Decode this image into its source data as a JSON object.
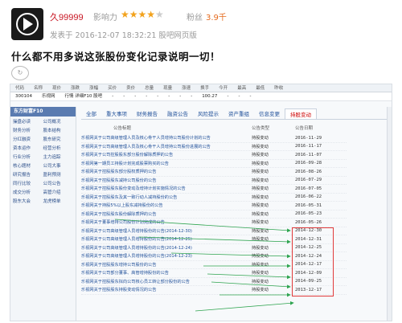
{
  "post": {
    "username": "久99999",
    "influence_label": "影响力",
    "stars_filled": "★★★★",
    "stars_empty": "★",
    "rating": 4,
    "fans_label": "粉丝",
    "fans_value": "3.9千",
    "posted_line": "发表于 2016-12-07 18:32:21 股吧网页版",
    "title": "什么都不用多说这张股份变化记录说明一切！"
  },
  "quote_bar": {
    "headers": [
      "代码",
      "名称",
      "现价",
      "涨跌",
      "涨幅",
      "买价",
      "卖价",
      "总量",
      "现量",
      "涨速",
      "换手",
      "今开",
      "最高",
      "最低",
      "昨收"
    ],
    "row": [
      "300104",
      "乐视网",
      "行情 详细F10 股吧",
      "-",
      "-",
      "-",
      "-",
      "-",
      "-",
      "-",
      "-",
      "100.27",
      "-",
      "-",
      "-"
    ]
  },
  "nav": {
    "title": "东方财富F10",
    "items": [
      "操盘必读",
      "公司概况",
      "财务分析",
      "股本结构",
      "分红融资",
      "股东研究",
      "资本运作",
      "经营分析",
      "行业分析",
      "主力追踪",
      "核心题材",
      "公司大事",
      "研究报告",
      "盈利预测",
      "同行比较",
      "公司公告",
      "成交分析",
      "高管介绍",
      "股东大会",
      "龙虎榜单"
    ]
  },
  "tabs": [
    "全部",
    "重大事项",
    "财务报告",
    "融资公告",
    "风险提示",
    "资产重组",
    "信息变更",
    "持股变动"
  ],
  "columns": {
    "title": "公告标题",
    "type": "公告类型",
    "date": "公告日期"
  },
  "announcements": [
    {
      "title": "乐视网关于公司高级管理人员及核心骨干人员增持公司股份计划的公告",
      "type": "持股变动",
      "date": "2016-11-29"
    },
    {
      "title": "乐视网关于公司高级管理人员及核心骨干人员增持公司股份进展的公告",
      "type": "持股变动",
      "date": "2016-11-17"
    },
    {
      "title": "乐视网关于公司控股股东部分股份解除质押的公告",
      "type": "持股变动",
      "date": "2016-11-07"
    },
    {
      "title": "乐视网第一期员工持股计划完成股票购买的公告",
      "type": "持股变动",
      "date": "2016-09-28"
    },
    {
      "title": "乐视网关于控股股东部分股权质押的公告",
      "type": "持股变动",
      "date": "2016-08-26"
    },
    {
      "title": "乐视网关于控股股东减持公司股份的公告",
      "type": "持股变动",
      "date": "2016-07-29"
    },
    {
      "title": "乐视网关于控股股东股份变动及增持计划实施情况的公告",
      "type": "持股变动",
      "date": "2016-07-05"
    },
    {
      "title": "乐视网关于控股股东及其一致行动人减持股份的公告",
      "type": "持股变动",
      "date": "2016-06-22"
    },
    {
      "title": "乐视网关于持股5%以上股东减持股份的公告",
      "type": "持股变动",
      "date": "2016-05-31"
    },
    {
      "title": "乐视网关于控股股东股份解除质押的公告",
      "type": "持股变动",
      "date": "2016-05-23"
    },
    {
      "title": "乐视网关于董事增持公司股份计划完成的公告",
      "type": "持股变动",
      "date": "2016-05-26"
    },
    {
      "title": "乐视网关于公司高级管理人员增持股份的公告(2014-12-30)",
      "type": "持股变动",
      "date": "2014-12-30"
    },
    {
      "title": "乐视网关于公司高级管理人员增持股份的公告(2014-12-25)",
      "type": "持股变动",
      "date": "2014-12-31"
    },
    {
      "title": "乐视网关于公司高级管理人员增持股份的公告(2014-12-24)",
      "type": "持股变动",
      "date": "2014-12-25"
    },
    {
      "title": "乐视网关于公司高级管理人员增持股份的公告(2014-12-23)",
      "type": "持股变动",
      "date": "2014-12-24"
    },
    {
      "title": "乐视网关于控股股东增持公司股份的公告",
      "type": "持股变动",
      "date": "2014-12-17"
    },
    {
      "title": "乐视网关于公司部分董事、高管增持股份的公告",
      "type": "持股变动",
      "date": "2014-12-09"
    },
    {
      "title": "乐视网关于控股股东拟向公司核心员工转让部分股份的公告",
      "type": "持股变动",
      "date": "2014-09-25"
    },
    {
      "title": "乐视网关于控股股东持股变动情况的公告",
      "type": "持股变动",
      "date": "2013-12-17"
    }
  ]
}
